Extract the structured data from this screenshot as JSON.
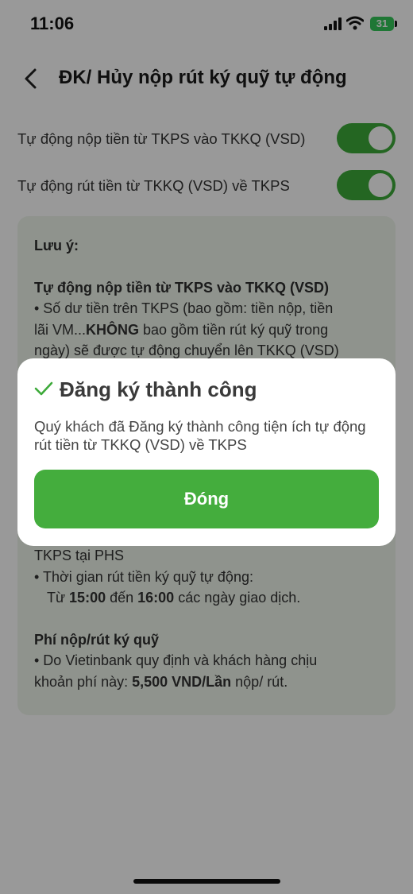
{
  "status_bar": {
    "time": "11:06",
    "battery": "31"
  },
  "header": {
    "title": "ĐK/ Hủy nộp rút ký quỹ tự động"
  },
  "toggles": [
    {
      "label": "Tự động nộp tiền từ TKPS vào TKKQ (VSD)",
      "on": true
    },
    {
      "label": "Tự động rút tiền từ TKKQ (VSD) về TKPS",
      "on": true
    }
  ],
  "note": {
    "heading": "Lưu ý:",
    "section1_title": "Tự động nộp tiền từ TKPS vào TKKQ (VSD)",
    "section1_line1": "• Số dư tiền trên TKPS (bao gồm: tiền nộp, tiền",
    "section1_line2_pre": "lãi VM...",
    "section1_line2_bold": "KHÔNG",
    "section1_line2_post": " bao gồm tiền rút ký quỹ trong",
    "section1_line3": "ngày) sẽ được tự động chuyển lên TKKQ (VSD)",
    "section2_line_partial": "TKPS tại PHS",
    "section2_time_label": "• Thời gian rút tiền ký quỹ tự động:",
    "section2_time_from": "Từ ",
    "section2_time_start": "15:00",
    "section2_time_mid": " đến ",
    "section2_time_end": "16:00",
    "section2_time_post": " các ngày giao dịch.",
    "fee_title": "Phí nộp/rút ký quỹ",
    "fee_line1": "• Do Vietinbank quy định và khách hàng chịu",
    "fee_line2_pre": "khoản phí này: ",
    "fee_line2_bold": "5,500 VND/Lần",
    "fee_line2_post": " nộp/ rút."
  },
  "modal": {
    "title": "Đăng ký thành công",
    "message": "Quý khách đã Đăng ký thành công tiện ích tự động rút tiền từ TKKQ (VSD) về TKPS",
    "button_label": "Đóng"
  },
  "colors": {
    "accent": "#3daa3a",
    "button": "#44ad3d",
    "note_bg": "#eef5ec"
  }
}
